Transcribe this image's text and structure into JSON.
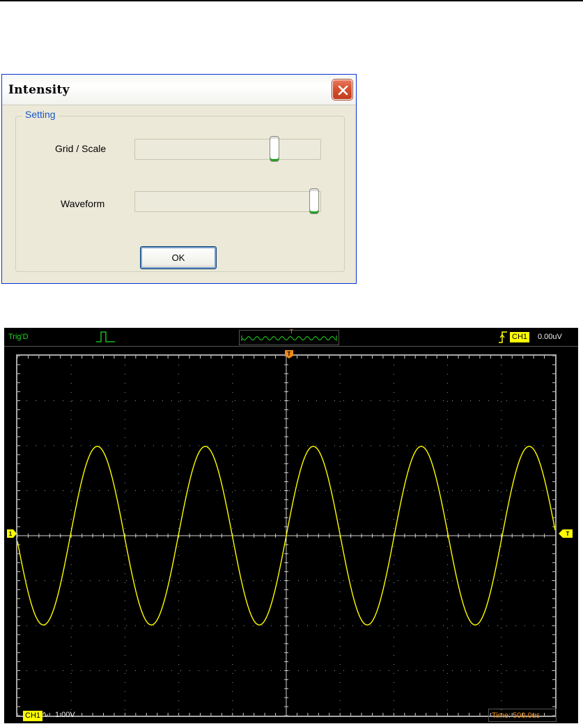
{
  "dialog": {
    "title": "Intensity",
    "group_title": "Setting",
    "grid_scale_label": "Grid / Scale",
    "waveform_label": "Waveform",
    "grid_scale_level": 0.77,
    "waveform_level": 1.0,
    "ok_label": "OK"
  },
  "scope": {
    "trigger_state": "Trig'D",
    "trigger_position_marker": "T",
    "trigger_source": "CH1",
    "trigger_level": "0.00uV",
    "channel_label": "CH1",
    "channel_marker": "1",
    "trigger_level_marker": "T",
    "coupling_symbol": "∿",
    "volts_per_div": "1.00V",
    "time_base": "Time: 500.0us",
    "waveform_color": "#ffff00",
    "accent_orange": "#f08c1a",
    "status_green": "#21d821"
  }
}
